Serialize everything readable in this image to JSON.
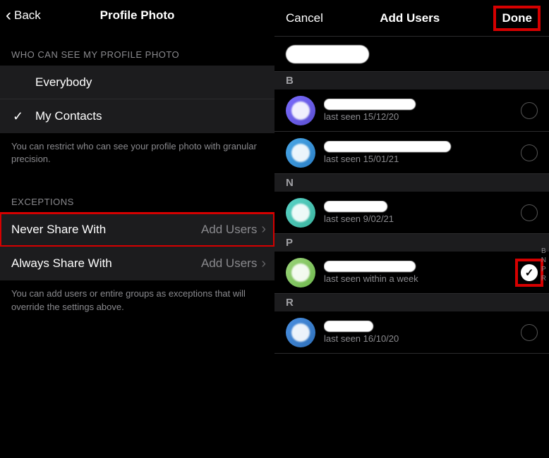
{
  "left": {
    "back_label": "Back",
    "title": "Profile Photo",
    "section1_header": "WHO CAN SEE MY PROFILE PHOTO",
    "options": [
      {
        "label": "Everybody",
        "selected": false
      },
      {
        "label": "My Contacts",
        "selected": true
      }
    ],
    "footer1": "You can restrict who can see your profile photo with granular precision.",
    "section2_header": "EXCEPTIONS",
    "exceptions": [
      {
        "label": "Never Share With",
        "action": "Add Users",
        "highlighted": true
      },
      {
        "label": "Always Share With",
        "action": "Add Users",
        "highlighted": false
      }
    ],
    "footer2": "You can add users or entire groups as exceptions that will override the settings above."
  },
  "right": {
    "cancel": "Cancel",
    "title": "Add Users",
    "done": "Done",
    "sections": [
      {
        "letter": "B",
        "contacts": [
          {
            "last_seen": "last seen 15/12/20",
            "avatar": "av-purple",
            "selected": false
          },
          {
            "last_seen": "last seen 15/01/21",
            "avatar": "av-blue",
            "selected": false
          }
        ]
      },
      {
        "letter": "N",
        "contacts": [
          {
            "last_seen": "last seen 9/02/21",
            "avatar": "av-teal",
            "selected": false
          }
        ]
      },
      {
        "letter": "P",
        "contacts": [
          {
            "last_seen": "last seen within a week",
            "avatar": "av-green",
            "selected": true,
            "highlighted": true
          }
        ]
      },
      {
        "letter": "R",
        "contacts": [
          {
            "last_seen": "last seen 16/10/20",
            "avatar": "av-blue2",
            "selected": false
          }
        ]
      }
    ],
    "index_letters": [
      "B",
      "N",
      "P",
      "R"
    ]
  }
}
